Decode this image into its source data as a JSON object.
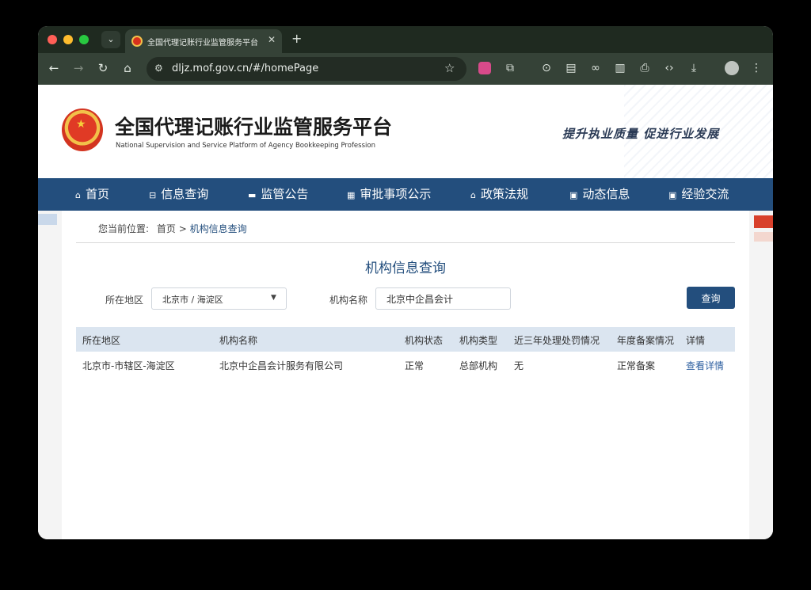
{
  "browser": {
    "tab_title": "全国代理记账行业监管服务平台",
    "url": "dljz.mof.gov.cn/#/homePage"
  },
  "header": {
    "title": "全国代理记账行业监管服务平台",
    "subtitle": "National Supervision and Service Platform of Agency Bookkeeping  Profession",
    "slogan": "提升执业质量   促进行业发展"
  },
  "nav": {
    "items": [
      {
        "label": "首页",
        "icon": "home-icon"
      },
      {
        "label": "信息查询",
        "icon": "info-icon"
      },
      {
        "label": "监管公告",
        "icon": "monitor-icon"
      },
      {
        "label": "审批事项公示",
        "icon": "grid-icon"
      },
      {
        "label": "政策法规",
        "icon": "building-icon"
      },
      {
        "label": "动态信息",
        "icon": "news-icon"
      },
      {
        "label": "经验交流",
        "icon": "chat-icon"
      }
    ]
  },
  "breadcrumb": {
    "prefix": "您当前位置:",
    "home": "首页",
    "separator": ">",
    "current": "机构信息查询"
  },
  "search": {
    "title": "机构信息查询",
    "region_label": "所在地区",
    "region_value": "北京市 / 海淀区",
    "name_label": "机构名称",
    "name_value": "北京中企昌会计",
    "button_label": "查询"
  },
  "table": {
    "columns": [
      "所在地区",
      "机构名称",
      "机构状态",
      "机构类型",
      "近三年处理处罚情况",
      "年度备案情况",
      "详情"
    ],
    "rows": [
      {
        "region": "北京市-市辖区-海淀区",
        "name": "北京中企昌会计服务有限公司",
        "status": "正常",
        "type": "总部机构",
        "penalty": "无",
        "filing": "正常备案",
        "detail": "查看详情"
      }
    ]
  }
}
